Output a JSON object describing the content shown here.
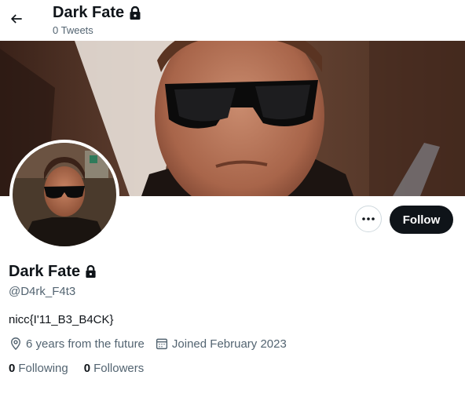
{
  "header": {
    "title": "Dark Fate",
    "tweet_count": "0 Tweets"
  },
  "profile": {
    "display_name": "Dark Fate",
    "handle": "@D4rk_F4t3",
    "bio": "nicc{I'11_B3_B4CK}",
    "location": "6 years from the future",
    "joined": "Joined February 2023",
    "following_count": "0",
    "following_label": "Following",
    "followers_count": "0",
    "followers_label": "Followers"
  },
  "actions": {
    "follow_label": "Follow"
  },
  "icons": {
    "back": "arrow-left-icon",
    "protected": "lock-icon",
    "more": "more-horizontal-icon",
    "location": "location-pin-icon",
    "calendar": "calendar-icon"
  },
  "colors": {
    "text": "#0f1419",
    "secondary_text": "#536471",
    "follow_button": "#0f1419",
    "border": "#cfd9de"
  }
}
